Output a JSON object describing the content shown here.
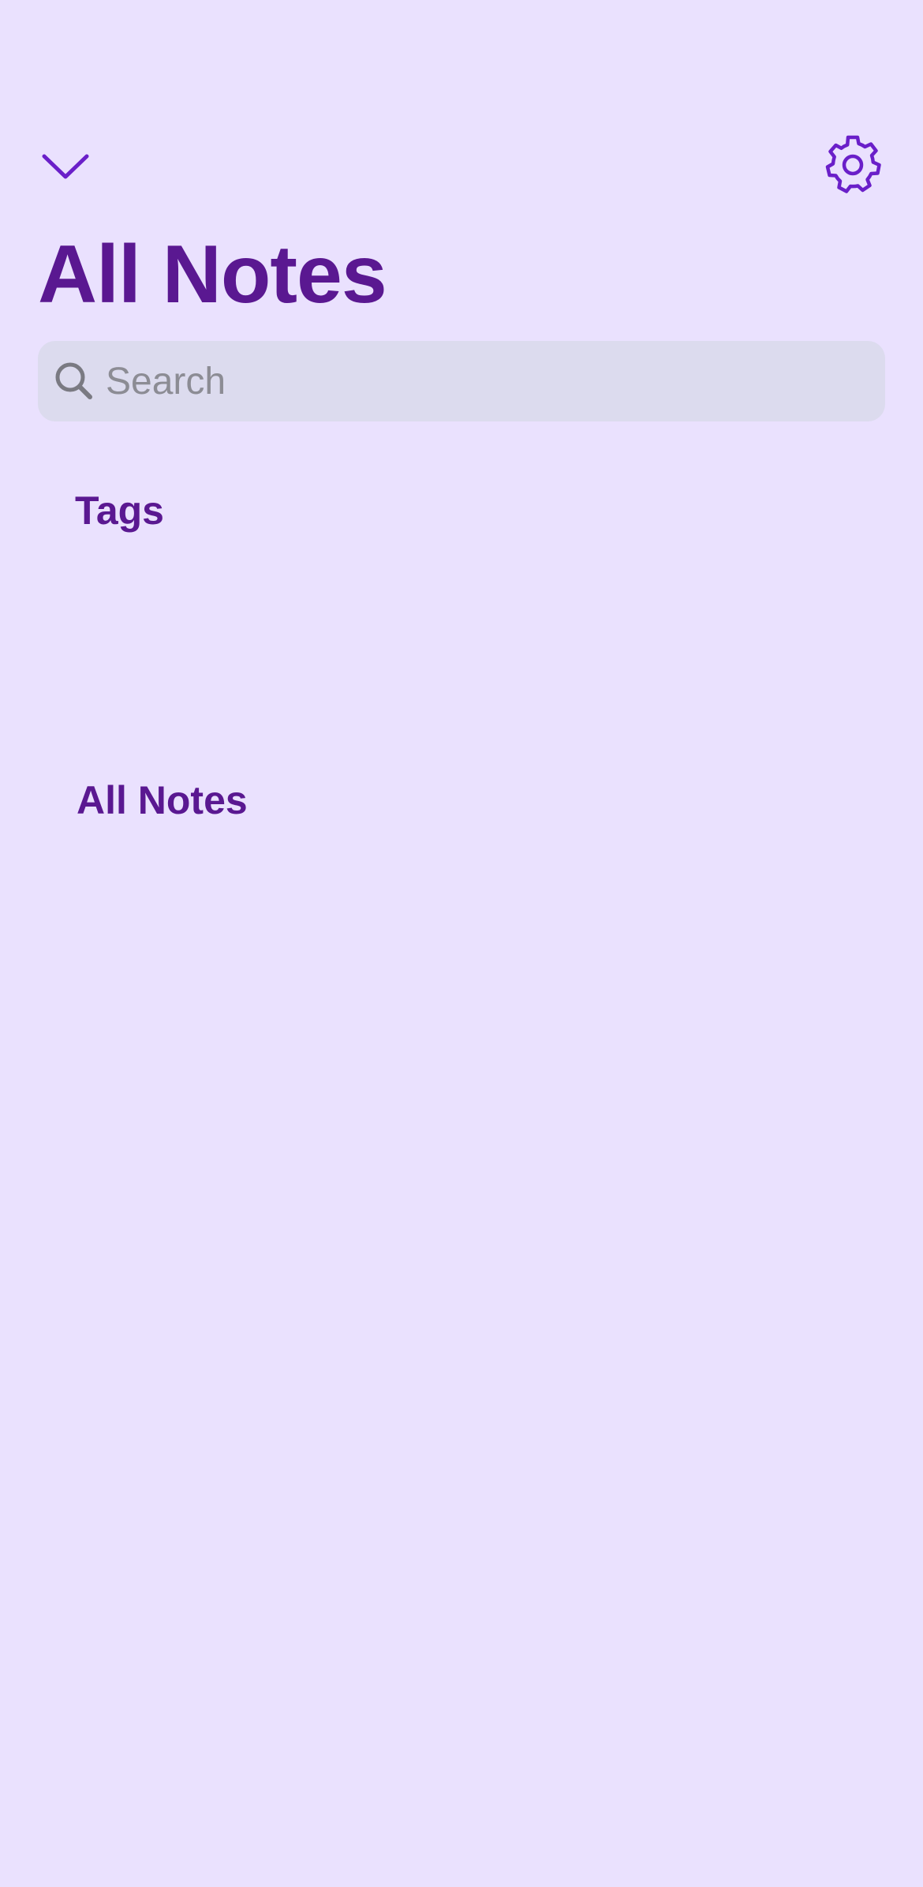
{
  "header": {
    "collapse_icon": "chevron-down-icon",
    "settings_icon": "gear-icon",
    "title": "All Notes"
  },
  "search": {
    "icon": "search-icon",
    "placeholder": "Search",
    "value": ""
  },
  "sidebar": {
    "tags_label": "Tags",
    "all_notes_label": "All Notes"
  },
  "colors": {
    "background": "#EAE1FE",
    "accent": "#5A1891",
    "icon": "#6A1FC9",
    "search_field": "#DCDBEE",
    "placeholder": "#8C8C94"
  }
}
